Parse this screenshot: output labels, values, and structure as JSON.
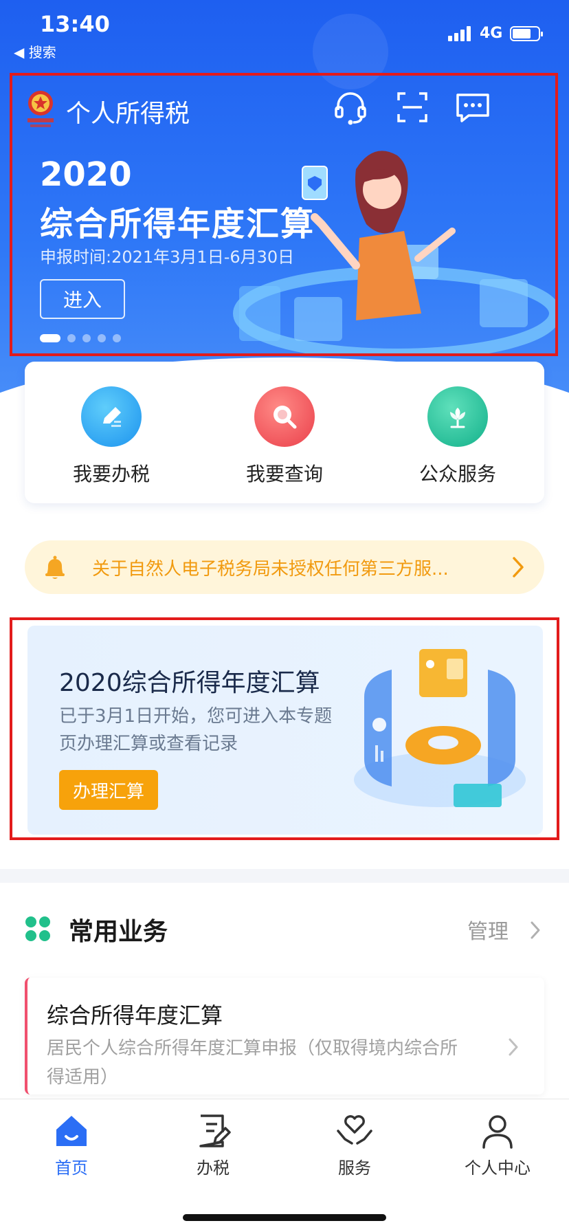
{
  "status_bar": {
    "time": "13:40",
    "back_label": "◀ 搜索",
    "network": "4G"
  },
  "header": {
    "app_title": "个人所得税",
    "icons": [
      "headset-icon",
      "scan-icon",
      "message-icon"
    ]
  },
  "banner": {
    "year": "2020",
    "title": "综合所得年度汇算",
    "date": "申报时间:2021年3月1日-6月30日",
    "enter_label": "进入",
    "page_count": 5,
    "active_index": 0
  },
  "quick_actions": [
    {
      "label": "我要办税",
      "icon": "edit-icon",
      "color": "#2aa9f4"
    },
    {
      "label": "我要查询",
      "icon": "search-icon",
      "color": "#f1535a"
    },
    {
      "label": "公众服务",
      "icon": "flower-icon",
      "color": "#27c39a"
    }
  ],
  "notice": {
    "text": "关于自然人电子税务局未授权任何第三方服...",
    "icon": "bell-icon"
  },
  "annual_card": {
    "title": "2020综合所得年度汇算",
    "description": "已于3月1日开始，您可进入本专题页办理汇算或查看记录",
    "button_label": "办理汇算"
  },
  "common_business": {
    "title": "常用业务",
    "manage_label": "管理",
    "items": [
      {
        "title": "综合所得年度汇算",
        "description": "居民个人综合所得年度汇算申报（仅取得境内综合所得适用）"
      }
    ]
  },
  "tabs": [
    {
      "label": "首页",
      "icon": "home-icon",
      "active": true
    },
    {
      "label": "办税",
      "icon": "document-icon",
      "active": false
    },
    {
      "label": "服务",
      "icon": "heart-hands-icon",
      "active": false
    },
    {
      "label": "个人中心",
      "icon": "user-icon",
      "active": false
    }
  ],
  "colors": {
    "primary": "#2b6ef5",
    "accent": "#f7a20b",
    "notice_text": "#f19a0f",
    "highlight_border": "#e21b1b"
  }
}
